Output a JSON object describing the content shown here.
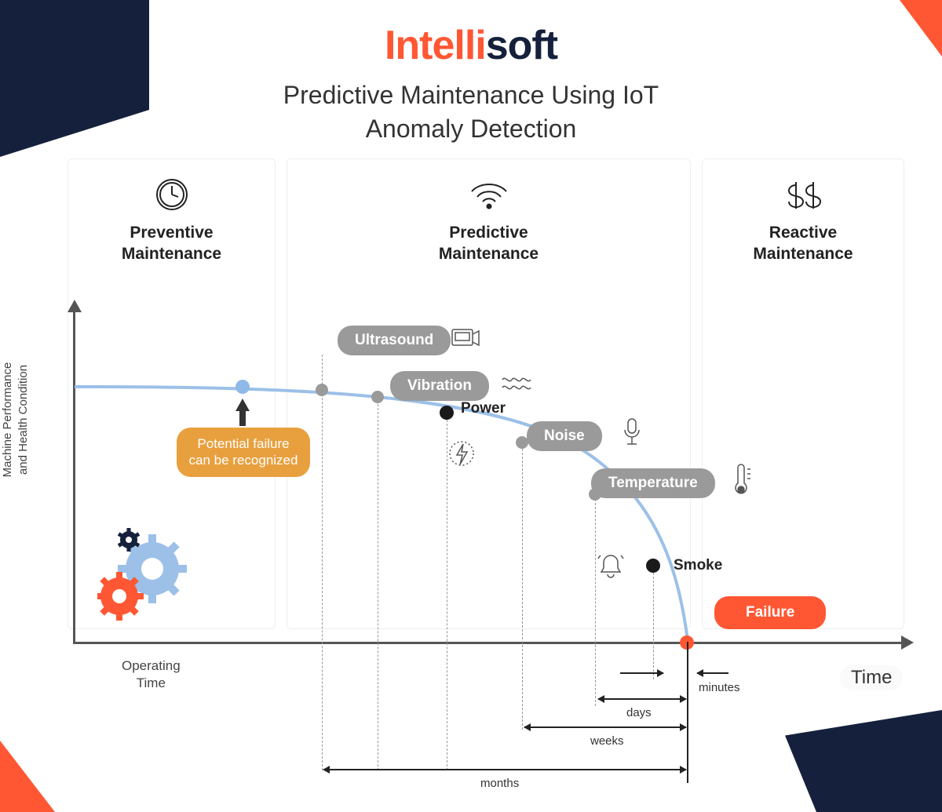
{
  "logo": {
    "part1": "Intelli",
    "part2": "soft"
  },
  "title_line1": "Predictive Maintenance Using IoT",
  "title_line2": "Anomaly Detection",
  "panels": {
    "preventive": {
      "line1": "Preventive",
      "line2": "Maintenance"
    },
    "predictive": {
      "line1": "Predictive",
      "line2": "Maintenance"
    },
    "reactive": {
      "line1": "Reactive",
      "line2": "Maintenance"
    }
  },
  "y_axis_label": "Machine Performance and Health Condition",
  "x_axis_label": "Operating Time",
  "time_label": "Time",
  "callout": "Potential failure can be recognized",
  "sensors": {
    "ultrasound": "Ultrasound",
    "vibration": "Vibration",
    "power": "Power",
    "noise": "Noise",
    "temperature": "Temperature",
    "smoke": "Smoke"
  },
  "failure": "Failure",
  "timescale": {
    "minutes": "minutes",
    "days": "days",
    "weeks": "weeks",
    "months": "months"
  },
  "chart_data": {
    "type": "line",
    "title": "Predictive Maintenance Using IoT Anomaly Detection",
    "xlabel": "Operating Time",
    "ylabel": "Machine Performance and Health Condition",
    "curve_note": "Monotonically decreasing machine-health curve; qualitative (no numeric axis ticks shown).",
    "points_along_curve": [
      {
        "name": "potential-failure-recognized",
        "time_before_failure": "very early",
        "marker": "blue"
      },
      {
        "name": "Ultrasound",
        "time_before_failure": "months",
        "marker": "gray"
      },
      {
        "name": "Vibration",
        "time_before_failure": "months",
        "marker": "gray"
      },
      {
        "name": "Power",
        "time_before_failure": "months",
        "marker": "black"
      },
      {
        "name": "Noise",
        "time_before_failure": "weeks",
        "marker": "gray"
      },
      {
        "name": "Temperature",
        "time_before_failure": "days",
        "marker": "gray"
      },
      {
        "name": "Smoke",
        "time_before_failure": "minutes",
        "marker": "black"
      },
      {
        "name": "Failure",
        "time_before_failure": "0",
        "marker": "red"
      }
    ],
    "zones": [
      "Preventive Maintenance",
      "Predictive Maintenance",
      "Reactive Maintenance"
    ]
  }
}
